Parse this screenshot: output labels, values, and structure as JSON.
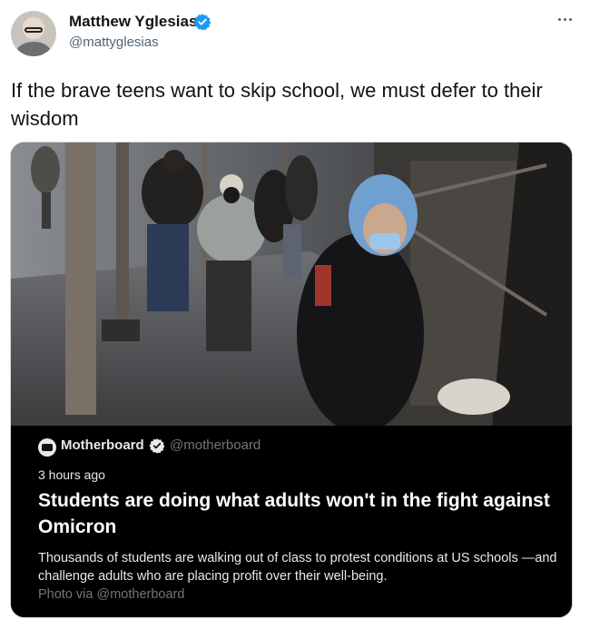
{
  "author": {
    "name": "Matthew Yglesias",
    "handle": "@mattyglesias"
  },
  "tweet": {
    "text": "If the brave teens want to skip school, we must defer to their wisdom"
  },
  "quoted": {
    "account_name": "Motherboard",
    "account_handle": "@motherboard",
    "time": "3 hours ago",
    "title": "Students are doing what adults won't in the fight against Omicron",
    "description": "Thousands of students are walking out of class to protest conditions at US schools —and challenge adults who are placing profit over their well-being.",
    "photo_credit": "Photo via @motherboard"
  },
  "colors": {
    "verified_blue": "#1d9bf0",
    "card_background": "#000000",
    "secondary_text": "#536471"
  },
  "icons": [
    "avatar",
    "verified-badge-icon",
    "more-options-icon",
    "motherboard-avatar-icon"
  ]
}
